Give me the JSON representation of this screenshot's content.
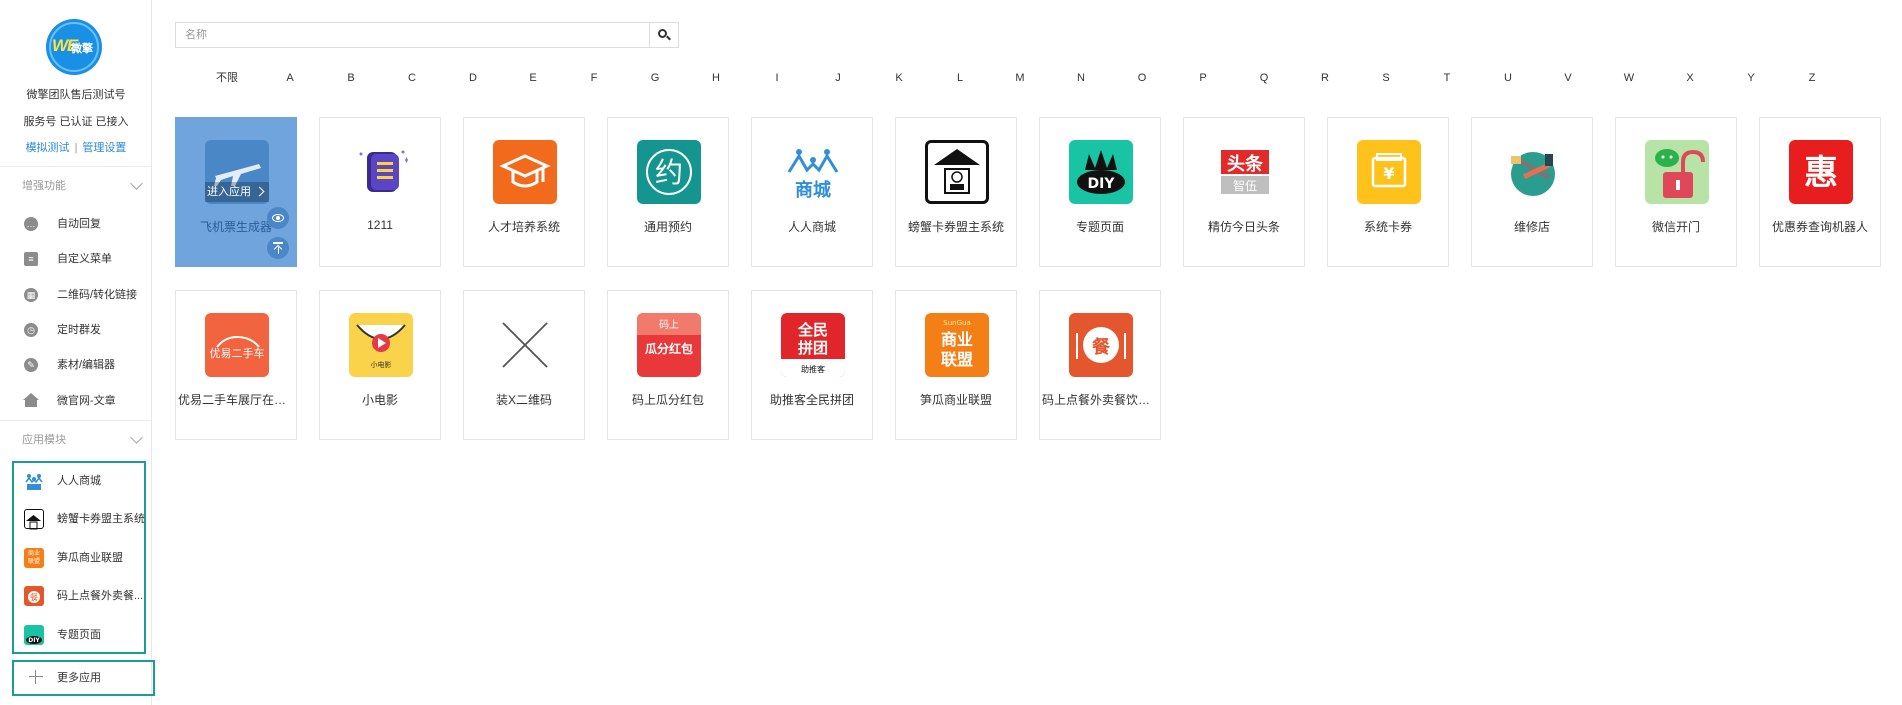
{
  "account": {
    "name": "微擎团队售后测试号",
    "status": "服务号 已认证 已接入",
    "link_simulate": "模拟测试",
    "link_separator": "|",
    "link_manage": "管理设置",
    "logo_text": "WE",
    "logo_text2": "微擎"
  },
  "sidebar": {
    "enhance_title": "增强功能",
    "enhance_items": [
      {
        "label": "自动回复",
        "icon": "chat-icon"
      },
      {
        "label": "自定义菜单",
        "icon": "document-icon"
      },
      {
        "label": "二维码/转化链接",
        "icon": "qrcode-icon"
      },
      {
        "label": "定时群发",
        "icon": "clock-icon"
      },
      {
        "label": "素材/编辑器",
        "icon": "pencil-icon"
      },
      {
        "label": "微官网-文章",
        "icon": "home-icon"
      }
    ],
    "modules_title": "应用模块",
    "module_items": [
      {
        "label": "人人商城",
        "color": "#ffffff"
      },
      {
        "label": "螃蟹卡券盟主系统",
        "color": "#ffffff"
      },
      {
        "label": "笋瓜商业联盟",
        "color": "#f57f17"
      },
      {
        "label": "码上点餐外卖餐...",
        "color": "#e4572e"
      },
      {
        "label": "专题页面",
        "color": "#19c4a4"
      }
    ],
    "more_label": "更多应用"
  },
  "search": {
    "placeholder": "名称",
    "value": ""
  },
  "letters": [
    "不限",
    "A",
    "B",
    "C",
    "D",
    "E",
    "F",
    "G",
    "H",
    "I",
    "J",
    "K",
    "L",
    "M",
    "N",
    "O",
    "P",
    "Q",
    "R",
    "S",
    "T",
    "U",
    "V",
    "W",
    "X",
    "Y",
    "Z"
  ],
  "tile_actions": {
    "enter_label": "进入应用"
  },
  "apps": [
    {
      "name": "飞机票生成器",
      "color": "#4a87c7",
      "glyph": "✈"
    },
    {
      "name": "1211",
      "color": "#ffffff",
      "glyph": "≡"
    },
    {
      "name": "人才培养系统",
      "color": "#f26b1d",
      "glyph": "🎓"
    },
    {
      "name": "通用预约",
      "color": "#14958f",
      "glyph": "约"
    },
    {
      "name": "人人商城",
      "color": "#ffffff",
      "glyph": "商城"
    },
    {
      "name": "螃蟹卡券盟主系统",
      "color": "#ffffff",
      "glyph": "⌂"
    },
    {
      "name": "专题页面",
      "color": "#19c4a4",
      "glyph": "DIY"
    },
    {
      "name": "精仿今日头条",
      "color": "#ffffff",
      "glyph": "头条"
    },
    {
      "name": "系统卡券",
      "color": "#ffc21a",
      "glyph": "¥"
    },
    {
      "name": "维修店",
      "color": "#ffffff",
      "glyph": "✚"
    },
    {
      "name": "微信开门",
      "color": "#b7e4a6",
      "glyph": "🔓"
    },
    {
      "name": "优惠券查询机器人",
      "color": "#e81e1e",
      "glyph": "惠"
    },
    {
      "name": "优易二手车展厅在线...",
      "color": "#f26340",
      "glyph": "二手车"
    },
    {
      "name": "小电影",
      "color": "#fbd34b",
      "glyph": "▶"
    },
    {
      "name": "装X二维码",
      "color": "#ffffff",
      "glyph": "✕"
    },
    {
      "name": "码上瓜分红包",
      "color": "#e8383a",
      "glyph": "红包"
    },
    {
      "name": "助推客全民拼团",
      "color": "#e0262a",
      "glyph": "拼团"
    },
    {
      "name": "笋瓜商业联盟",
      "color": "#f57f17",
      "glyph": "商业联盟"
    },
    {
      "name": "码上点餐外卖餐饮系...",
      "color": "#e4572e",
      "glyph": "餐"
    }
  ]
}
